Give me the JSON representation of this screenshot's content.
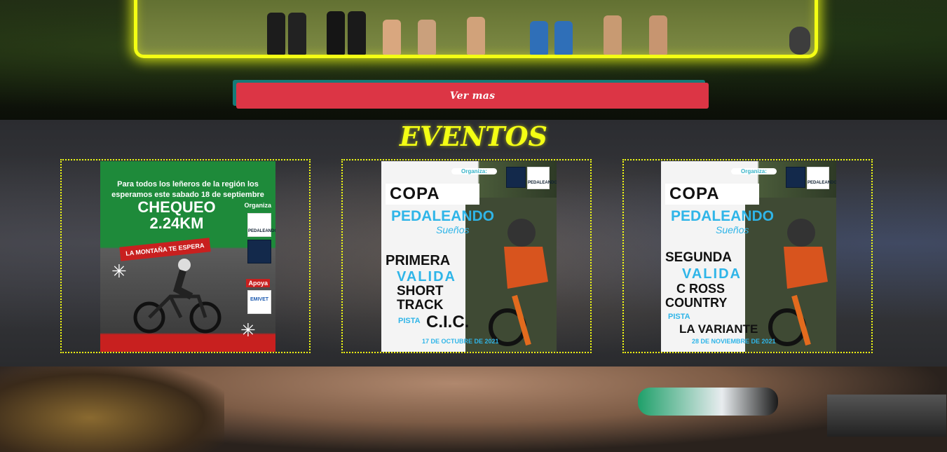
{
  "hero": {
    "button_label": "Ver mas"
  },
  "events": {
    "title": "EVENTOS",
    "posters": [
      {
        "intro": "Para todos los leñeros de la región los esperamos este sabado 18 de septiembre",
        "headline": "CHEQUEO 2.24KM",
        "organiza": "Organiza",
        "tagline": "LA MONTAÑA TE ESPERA",
        "apoya": "Apoya",
        "logo_1": "PEDALEANDO",
        "logo_2": "EMIVET"
      },
      {
        "organiza": "Organiza:",
        "copa": "COPA",
        "brand": "PEDALEANDO",
        "brand_sub": "Sueños",
        "line_1": "PRIMERA",
        "line_2": "VALIDA",
        "line_3": "SHORT",
        "line_4": "TRACK",
        "pista": "PISTA",
        "venue": "C.I.C.",
        "date": "17 DE OCTUBRE DE 2021",
        "logo": "PEDALEANDO"
      },
      {
        "organiza": "Organiza:",
        "copa": "COPA",
        "brand": "PEDALEANDO",
        "brand_sub": "Sueños",
        "line_1": "SEGUNDA",
        "line_2": "VALIDA",
        "line_3": "C ROSS",
        "line_4": "COUNTRY",
        "pista": "PISTA",
        "venue": "LA VARIANTE",
        "date": "28 DE NOVIEMBRE DE 2021",
        "logo": "PEDALEANDO"
      }
    ]
  },
  "colors": {
    "neon_yellow": "#f4ff14",
    "button_red": "#dc3545",
    "button_shadow": "#167a78",
    "brand_cyan": "#2fb5e8"
  }
}
